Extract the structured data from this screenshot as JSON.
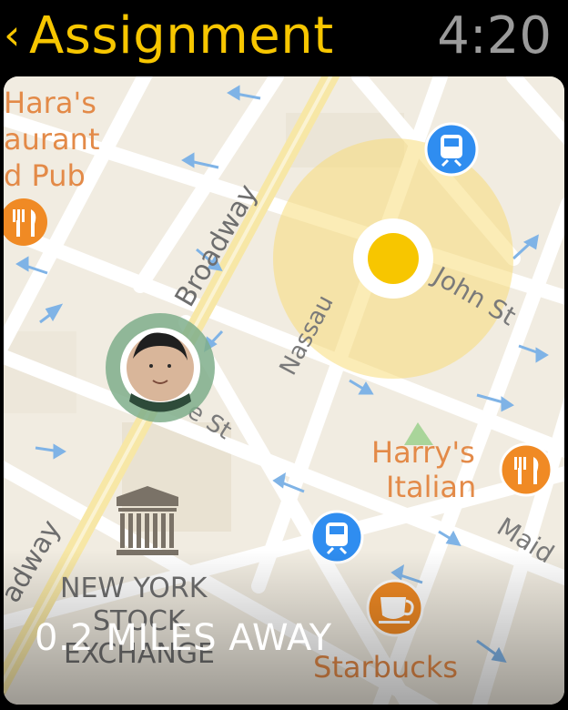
{
  "header": {
    "back_glyph": "‹",
    "title": "Assignment",
    "time": "4:20"
  },
  "map": {
    "labels": {
      "restaurant_line1": "Hara's",
      "restaurant_line2": "aurant",
      "restaurant_line3": "d Pub",
      "broadway_top": "Broadway",
      "broadway_bottom": "adway",
      "nassau": "Nassau",
      "john_st": "John St",
      "street_fragment": "e St",
      "harrys_line1": "Harry's",
      "harrys_line2": "Italian",
      "maiden": "Maid",
      "nyse_line1": "NEW YORK",
      "nyse_line2": "STOCK",
      "nyse_line3": "EXCHANGE",
      "starbucks": "Starbucks"
    },
    "colors": {
      "background": "#f1ece1",
      "road": "#ffffff",
      "major_road": "#f7e7a6",
      "poi_orange": "#f08a24",
      "transit_blue": "#2f8df0",
      "destination_yellow": "#f7c600",
      "destination_halo": "#f8dd7a",
      "user_ring": "#7fae8b"
    },
    "icons": [
      "fork-knife-icon",
      "train-icon",
      "bank-icon",
      "coffee-cup-icon",
      "user-avatar"
    ]
  },
  "status": {
    "distance": "0.2 MILES AWAY"
  }
}
